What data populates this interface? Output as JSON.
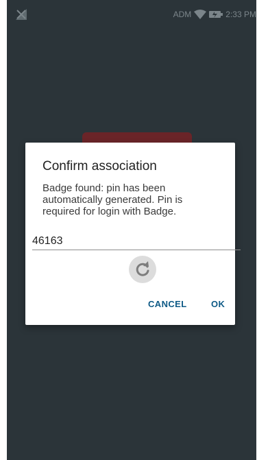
{
  "status_bar": {
    "carrier": "ADM",
    "time": "2:33 PM",
    "icons": [
      "no-signal-icon",
      "wifi-icon",
      "battery-icon"
    ]
  },
  "dialog": {
    "title": "Confirm association",
    "message": "Badge found: pin has been automatically generated. Pin is required for login with Badge.",
    "pin_value": "46163",
    "refresh_icon": "refresh-icon",
    "cancel_label": "CANCEL",
    "ok_label": "OK"
  },
  "colors": {
    "background": "#2b3439",
    "dialog": "#ffffff",
    "button_text": "#0e5a86",
    "status_text": "#7b858a",
    "logo_behind": "#7a2024"
  }
}
